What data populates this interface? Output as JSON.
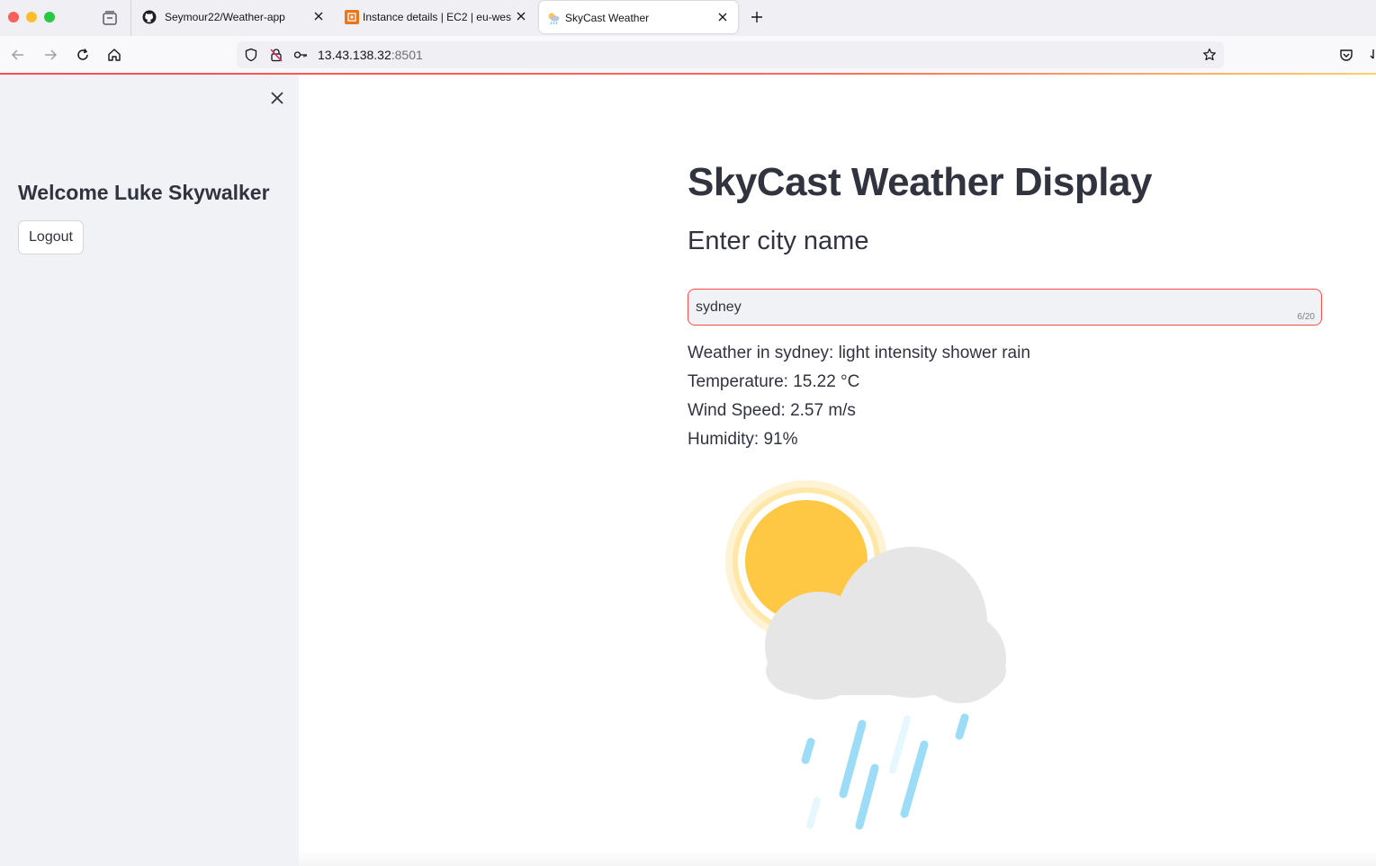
{
  "browser": {
    "tabs": [
      {
        "title": "Seymour22/Weather-app",
        "favicon": "github-icon",
        "active": false
      },
      {
        "title": "Instance details | EC2 | eu-west",
        "favicon": "aws-ec2-icon",
        "active": false
      },
      {
        "title": "SkyCast Weather",
        "favicon": "weather-icon",
        "active": true
      }
    ],
    "url_host": "13.43.138.32",
    "url_port": ":8501"
  },
  "sidebar": {
    "welcome": "Welcome Luke Skywalker",
    "logout_label": "Logout"
  },
  "main": {
    "title": "SkyCast Weather Display",
    "subtitle": "Enter city name",
    "city_input": {
      "value": "sydney",
      "char_count": "6/20"
    },
    "weather_lines": {
      "description": "Weather in sydney: light intensity shower rain",
      "temperature": "Temperature: 15.22 °C",
      "wind": "Wind Speed: 2.57 m/s",
      "humidity": "Humidity: 91%"
    },
    "weather_icon": "sun-cloud-rain-icon"
  },
  "colors": {
    "accent": "#ff4b4b",
    "sidebar_bg": "#f0f2f6",
    "text": "#31333f",
    "sun": "#ffc844",
    "cloud": "#e6e6e6",
    "rain": "#9cdcf7"
  }
}
